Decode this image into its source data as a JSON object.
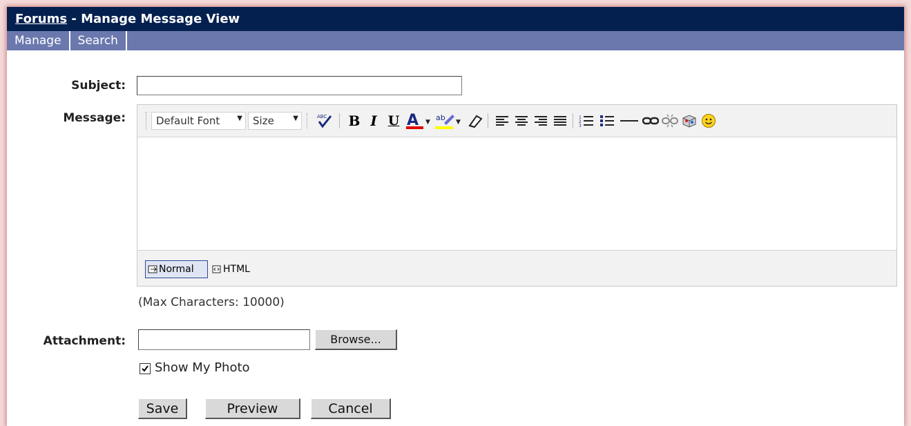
{
  "header": {
    "link_text": "Forums",
    "separator": " - ",
    "title": "Manage Message View"
  },
  "nav": {
    "items": [
      "Manage",
      "Search"
    ]
  },
  "form": {
    "subject_label": "Subject:",
    "subject_value": "",
    "message_label": "Message:",
    "max_chars": "(Max Characters: 10000)",
    "attachment_label": "Attachment:",
    "attachment_value": "",
    "browse_label": "Browse...",
    "show_photo_label": "Show My Photo",
    "show_photo_checked": true
  },
  "editor": {
    "font_select": "Default Font",
    "size_select": "Size",
    "mode_normal": "Normal",
    "mode_html": "HTML",
    "toolbar_icons": [
      "spellcheck-icon",
      "bold-icon",
      "italic-icon",
      "underline-icon",
      "font-color-icon",
      "highlight-icon",
      "eraser-icon",
      "align-left-icon",
      "align-center-icon",
      "align-right-icon",
      "justify-icon",
      "numbered-list-icon",
      "bullet-list-icon",
      "horizontal-rule-icon",
      "link-icon",
      "unlink-icon",
      "insert-image-icon",
      "emoticon-icon"
    ],
    "colors": {
      "font_color": "#e00000",
      "highlight": "#ffff00"
    }
  },
  "buttons": {
    "save": "Save",
    "preview": "Preview",
    "cancel": "Cancel"
  },
  "colors": {
    "title_bar": "#03204f",
    "nav_bar": "#6b78ae"
  }
}
